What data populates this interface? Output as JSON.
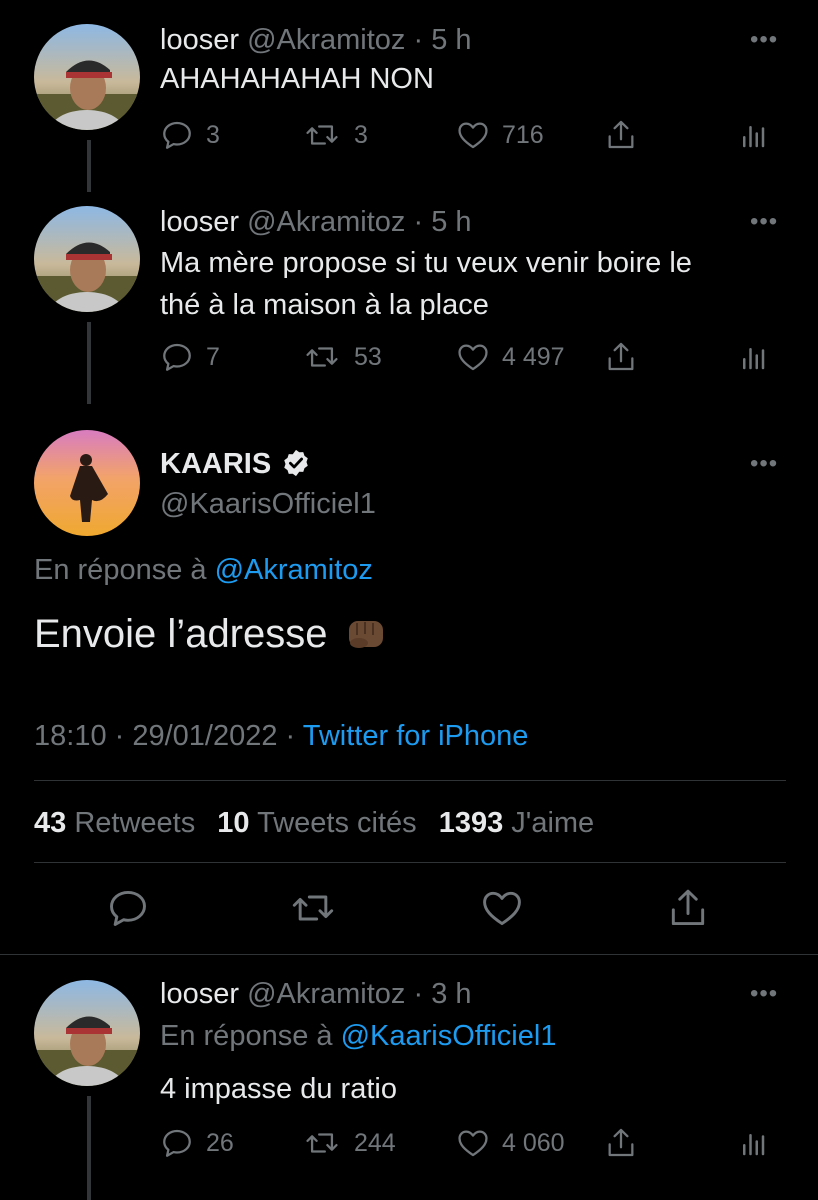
{
  "tweets": [
    {
      "name": "looser",
      "handle": "@Akramitoz",
      "time": "· 5 h",
      "lines": [
        "AHAHAHAHAH NON"
      ],
      "replies": "3",
      "retweets": "3",
      "likes": "716"
    },
    {
      "name": "looser",
      "handle": "@Akramitoz",
      "time": "· 5 h",
      "lines": [
        "Ma mère propose si tu veux venir boire le",
        "thé à la maison à la place"
      ],
      "replies": "7",
      "retweets": "53",
      "likes": "4 497"
    }
  ],
  "main": {
    "name": "KAARIS",
    "handle": "@KaarisOfficiel1",
    "reply_prefix": "En réponse à",
    "reply_to": "@Akramitoz",
    "text": "Envoie l’adresse",
    "timestamp": "18:10 · 29/01/2022 ·",
    "source": "Twitter for iPhone",
    "stats": {
      "retweets_count": "43",
      "retweets_label": "Retweets",
      "quotes_count": "10",
      "quotes_label": "Tweets cités",
      "likes_count": "1393",
      "likes_label": "J'aime"
    }
  },
  "reply": {
    "name": "looser",
    "handle": "@Akramitoz",
    "time": "· 3 h",
    "reply_prefix": "En réponse à",
    "reply_to": "@KaarisOfficiel1",
    "text": "4 impasse du ratio",
    "replies": "26",
    "retweets": "244",
    "likes": "4 060"
  },
  "more_glyph": "•••",
  "icons": [
    "reply-icon",
    "retweet-icon",
    "like-icon",
    "share-icon",
    "analytics-icon",
    "verified-badge-icon",
    "fist-emoji-icon"
  ],
  "colors": {
    "accent": "#1d9bf0",
    "muted": "#71767b",
    "text": "#e7e9ea",
    "background": "#000000"
  }
}
